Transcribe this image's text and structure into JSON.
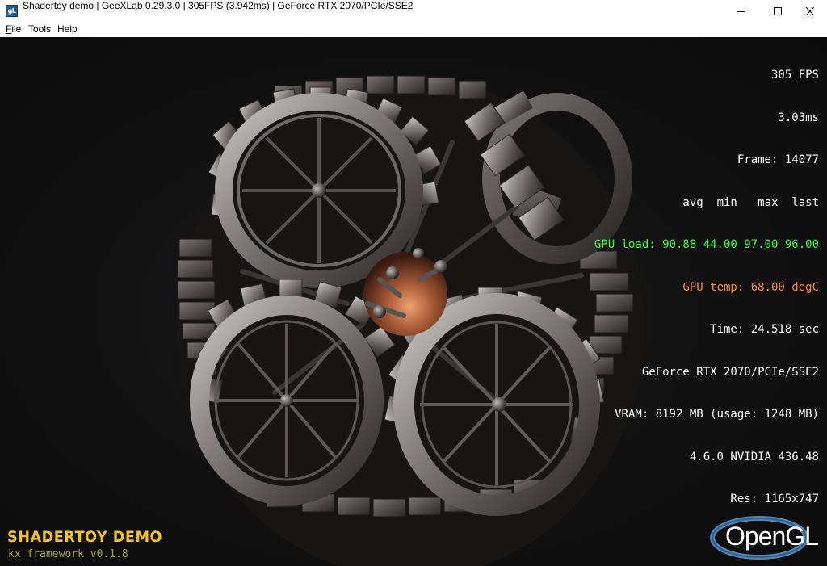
{
  "window": {
    "icon": "geexlab-app-icon",
    "icon_text": "gL",
    "title": "Shadertoy demo | GeeXLab 0.29.3.0 | 305FPS (3.942ms) | GeForce RTX 2070/PCIe/SSE2",
    "controls": [
      "minimize-icon",
      "maximize-icon",
      "close-icon"
    ]
  },
  "menu": {
    "file_mnemonic": "F",
    "file_rest": "ile",
    "tools": "Tools",
    "help": "Help"
  },
  "hud": {
    "fps": "305 FPS",
    "frame_time": "3.03ms",
    "frame": "Frame: 14077",
    "stats_header": "avg  min   max  last",
    "gpu_load": "GPU load: 90.88 44.00 97.00 96.00",
    "gpu_temp": "GPU temp: 68.00 degC",
    "time": "Time: 24.518 sec",
    "renderer": "GeForce RTX 2070/PCIe/SSE2",
    "vram": "VRAM: 8192 MB (usage: 1248 MB)",
    "gl_version": "4.6.0 NVIDIA 436.48",
    "resolution": "Res: 1165x747"
  },
  "overlay": {
    "demo_title": "SHADERTOY DEMO",
    "framework": "kx framework v0.1.8",
    "logo_text": "OpenGL"
  },
  "colors": {
    "gpu_load": "#33ff33",
    "gpu_temp": "#ff8c2e",
    "demo_title": "#f6c21e",
    "framework": "#a4a23c",
    "opengl_swoosh": "#4f86b8"
  }
}
